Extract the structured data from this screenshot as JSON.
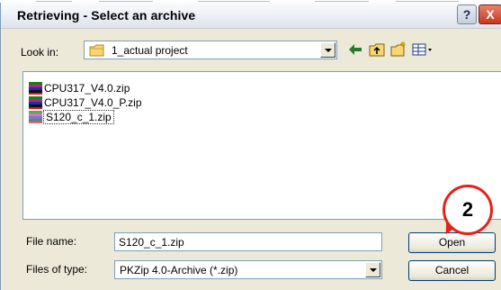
{
  "window": {
    "title": "Retrieving - Select an archive"
  },
  "titlebar": {
    "help_label": "?",
    "close_label": "X"
  },
  "lookin": {
    "label": "Look in:",
    "value": "1_actual project"
  },
  "files": [
    {
      "name": "CPU317_V4.0.zip",
      "selected": false
    },
    {
      "name": "CPU317_V4.0_P.zip",
      "selected": false
    },
    {
      "name": "S120_c_1.zip",
      "selected": true
    }
  ],
  "filename": {
    "label": "File name:",
    "value": "S120_c_1.zip"
  },
  "filetype": {
    "label": "Files of type:",
    "value": "PKZip 4.0-Archive (*.zip)"
  },
  "buttons": {
    "open": "Open",
    "cancel": "Cancel"
  },
  "callout": {
    "label": "2",
    "color": "#e4221b"
  },
  "icons": [
    "folder-icon",
    "back-arrow-icon",
    "up-folder-icon",
    "new-folder-icon",
    "view-menu-icon",
    "zip-file-icon"
  ]
}
